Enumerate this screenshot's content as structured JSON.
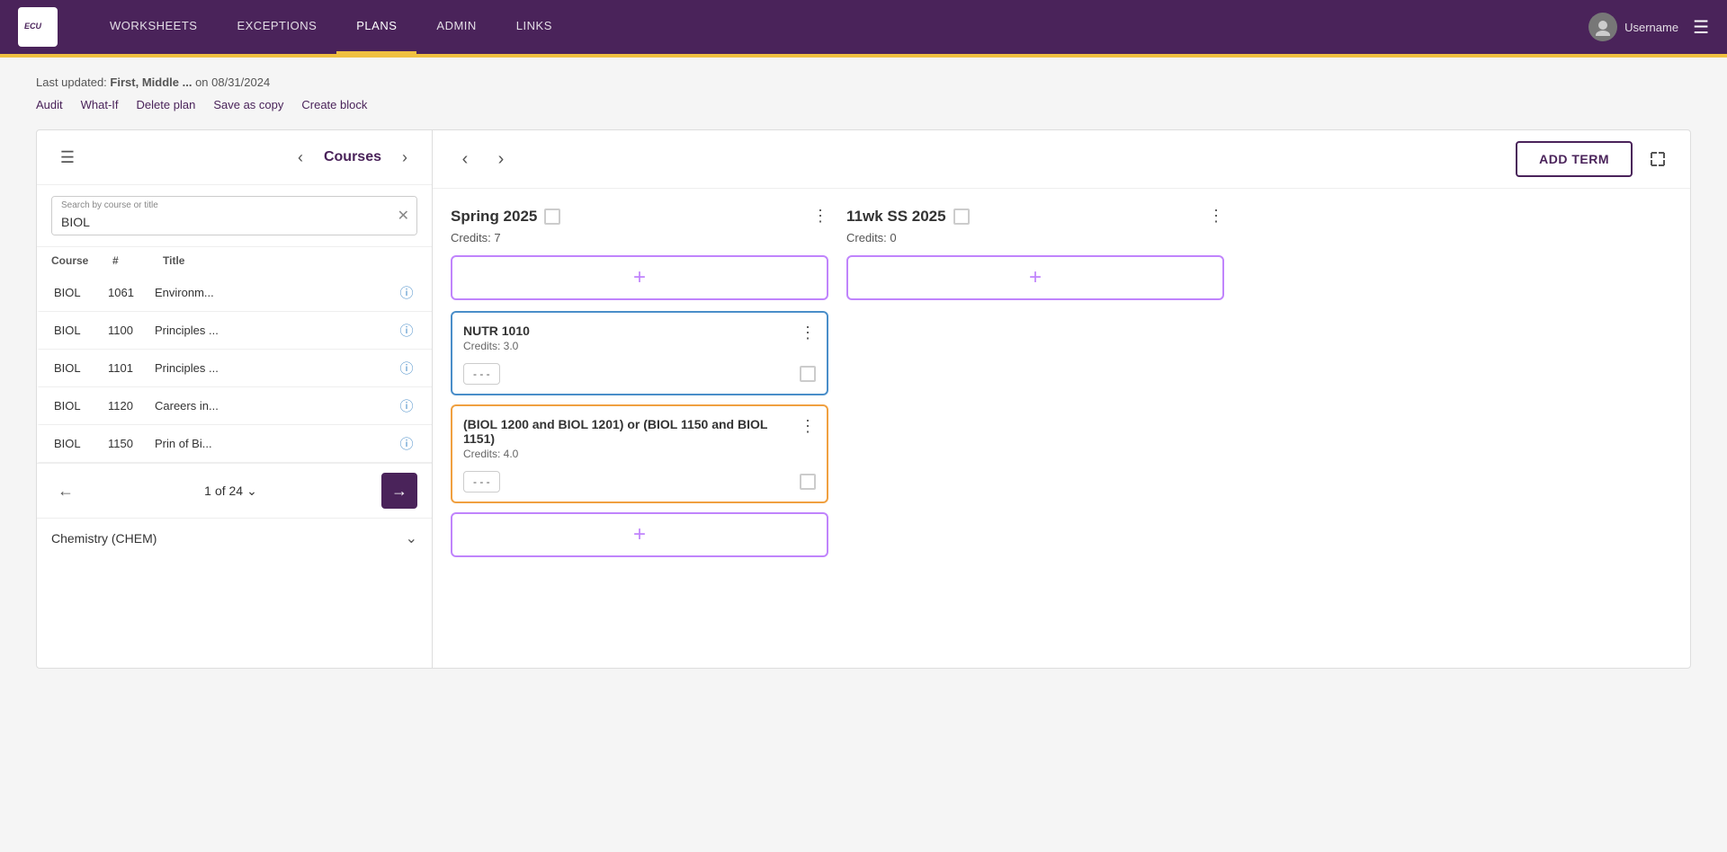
{
  "nav": {
    "logo_text": "ECU",
    "items": [
      {
        "label": "WORKSHEETS",
        "active": false
      },
      {
        "label": "EXCEPTIONS",
        "active": false
      },
      {
        "label": "PLANS",
        "active": true
      },
      {
        "label": "ADMIN",
        "active": false
      },
      {
        "label": "LINKS",
        "active": false
      }
    ],
    "username": "Username"
  },
  "page": {
    "last_updated_prefix": "Last updated:",
    "last_updated_user": "First, Middle ...",
    "last_updated_date": "on 08/31/2024",
    "actions": [
      {
        "label": "Audit"
      },
      {
        "label": "What-If"
      },
      {
        "label": "Delete plan"
      },
      {
        "label": "Save as copy"
      },
      {
        "label": "Create block"
      }
    ]
  },
  "sidebar": {
    "title": "Courses",
    "search_label": "Search by course or title",
    "search_value": "BIOL",
    "table_headers": [
      "Course",
      "#",
      "Title"
    ],
    "courses": [
      {
        "dept": "BIOL",
        "num": "1061",
        "title": "Environm..."
      },
      {
        "dept": "BIOL",
        "num": "1100",
        "title": "Principles ..."
      },
      {
        "dept": "BIOL",
        "num": "1101",
        "title": "Principles ..."
      },
      {
        "dept": "BIOL",
        "num": "1120",
        "title": "Careers in..."
      },
      {
        "dept": "BIOL",
        "num": "1150",
        "title": "Prin of Bi..."
      }
    ],
    "page_current": "1",
    "page_total": "24",
    "page_of": "of 24",
    "chemistry_section": "Chemistry (CHEM)"
  },
  "terms": [
    {
      "name": "Spring 2025",
      "credits_label": "Credits:",
      "credits": "7",
      "cards": [
        {
          "title": "NUTR 1010",
          "credits": "Credits: 3.0",
          "border": "active-blue",
          "grade": "- - -"
        },
        {
          "title": "(BIOL 1200 and BIOL 1201) or (BIOL 1150 and BIOL 1151)",
          "credits": "Credits: 4.0",
          "border": "active-orange",
          "grade": "- - -"
        }
      ]
    },
    {
      "name": "11wk SS 2025",
      "credits_label": "Credits:",
      "credits": "0",
      "cards": []
    }
  ],
  "buttons": {
    "add_term": "ADD TERM",
    "add_term_aria": "Add Term"
  },
  "icons": {
    "prev": "‹",
    "next": "›",
    "menu": "≡",
    "more": "⋮",
    "plus": "+",
    "expand": "⤢",
    "clear": "✕",
    "info": "ⓘ",
    "chevron_down": "∨",
    "check_empty": ""
  }
}
